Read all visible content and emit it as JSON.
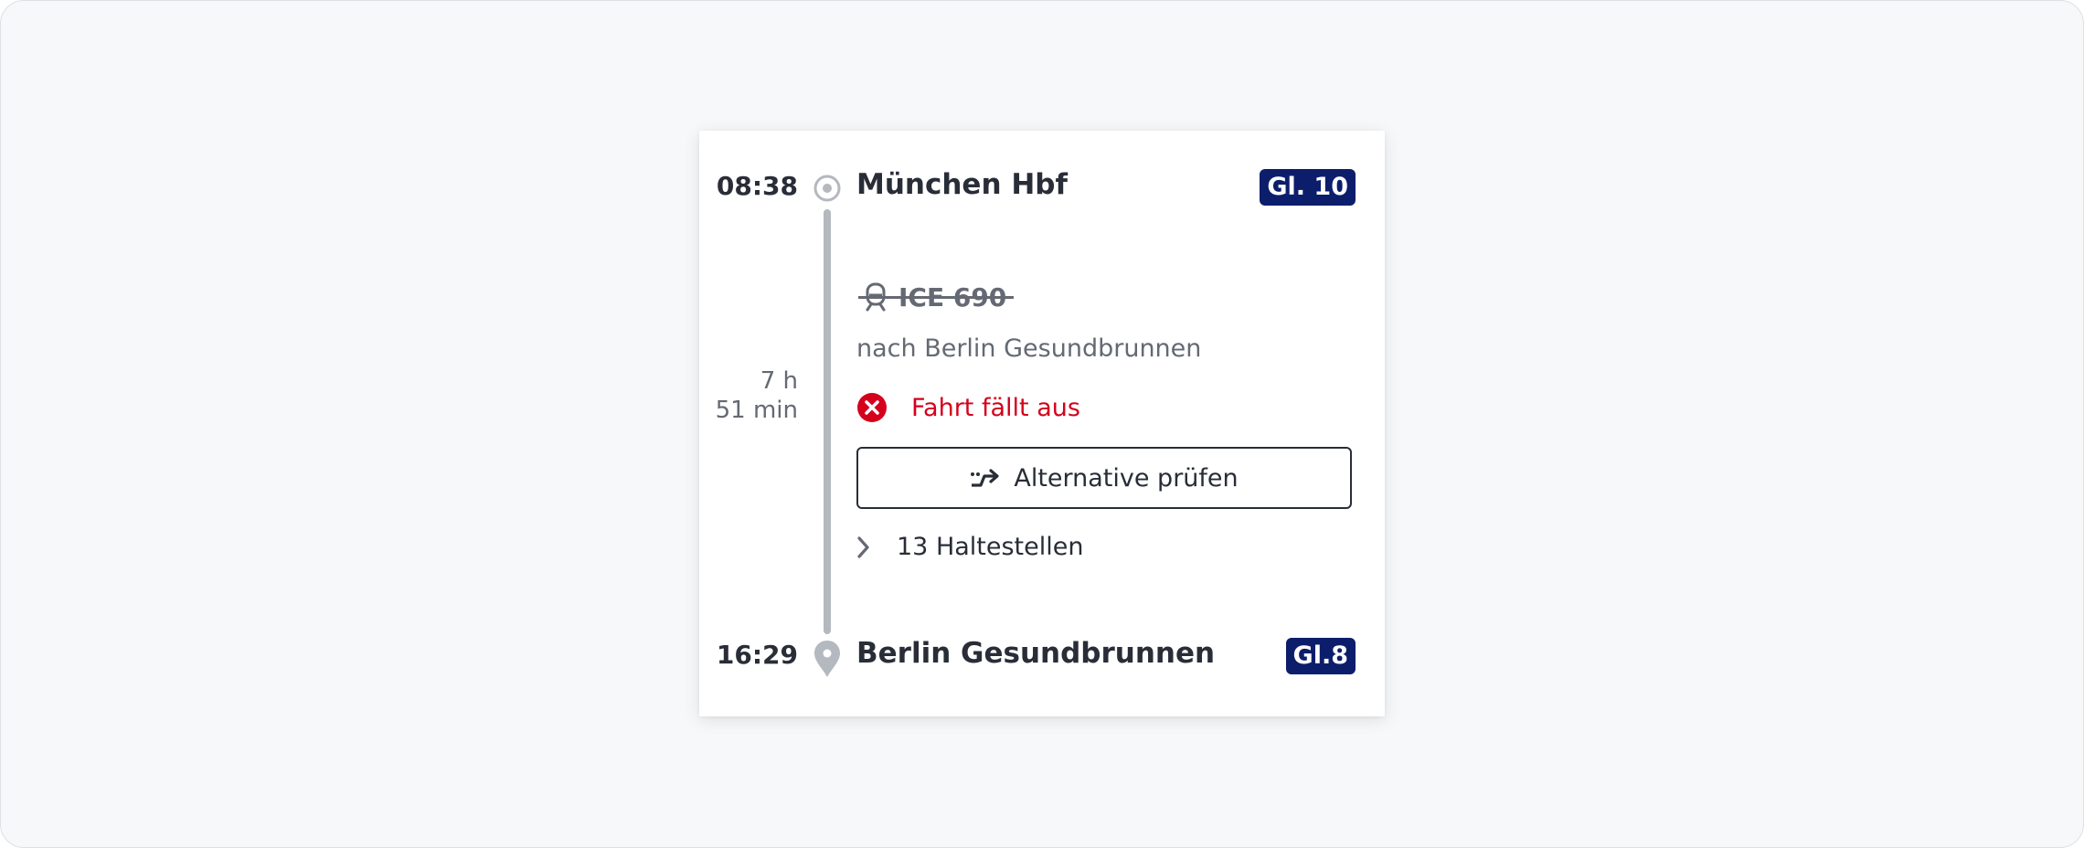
{
  "journey": {
    "departure": {
      "time": "08:38",
      "station": "München Hbf",
      "track": "Gl. 10"
    },
    "arrival": {
      "time": "16:29",
      "station": "Berlin Gesundbrunnen",
      "track": "Gl.8"
    },
    "duration": {
      "hours": "7 h",
      "minutes": "51 min"
    },
    "train": {
      "name": "ICE 690",
      "icon": "train-icon",
      "destination": "nach Berlin Gesundbrunnen"
    },
    "status": {
      "text": "Fahrt fällt aus",
      "icon": "cancel-icon",
      "color": "#d5001c"
    },
    "alternative_button": {
      "label": "Alternative prüfen",
      "icon": "alternative-route-icon"
    },
    "stops": {
      "label": "13 Haltestellen",
      "icon": "chevron-right-icon"
    }
  },
  "colors": {
    "track_badge": "#0c1e6b",
    "text_primary": "#282d37",
    "text_secondary": "#646973",
    "timeline": "#b4b8bf",
    "background": "#f7f8fa"
  }
}
